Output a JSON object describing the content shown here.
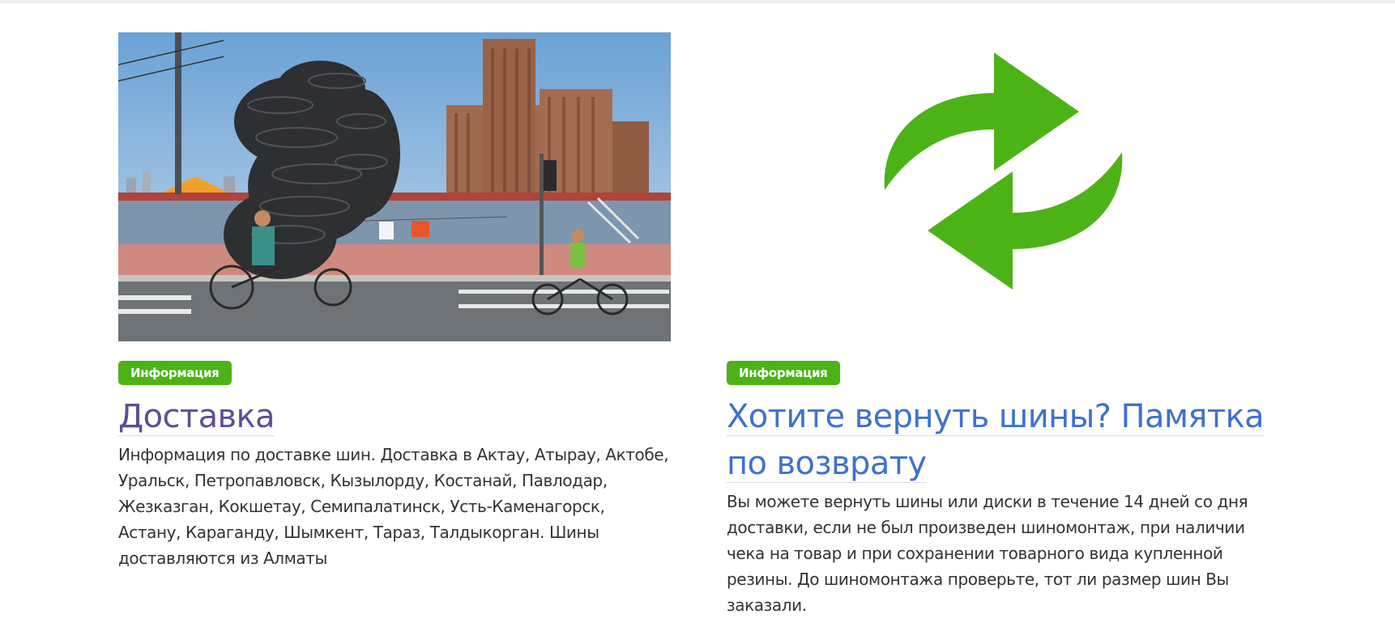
{
  "cards": [
    {
      "image_alt": "tires-delivery-photo",
      "badge": "Информация",
      "title": "Доставка",
      "description": "Информация по доставке шин. Доставка в Актау, Атырау, Актобе, Уральск, Петропавловск, Кызылорду, Костанай, Павлодар, Жезказган, Кокшетау, Семипалатинск, Усть-Каменагорск, Астану, Караганду, Шымкент, Тараз, Талдыкорган. Шины доставляются из Алматы"
    },
    {
      "image_alt": "refresh-arrows-icon",
      "badge": "Информация",
      "title": "Хотите вернуть шины? Памятка по возврату",
      "description": "Вы можете вернуть шины или диски в течение 14 дней со дня доставки, если не был произведен шиномонтаж, при наличии чека на товар и при сохранении товарного вида купленной резины. До шиномонтажа проверьте, тот ли размер шин Вы заказали."
    }
  ],
  "colors": {
    "badge_bg": "#4cb317",
    "title_visited": "#5e4d96",
    "title_link": "#3e72cc",
    "arrow_green": "#4cb317"
  }
}
